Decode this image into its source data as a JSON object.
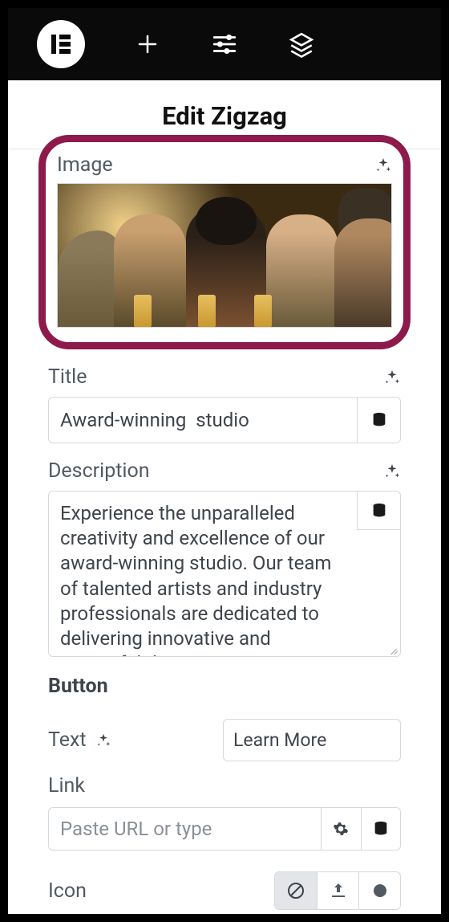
{
  "header": {
    "title": "Edit Zigzag"
  },
  "fields": {
    "image": {
      "label": "Image"
    },
    "title_field": {
      "label": "Title",
      "value": "Award-winning  studio"
    },
    "description": {
      "label": "Description",
      "value": "Experience the unparalleled creativity and excellence of our award-winning studio. Our team of talented artists and industry professionals are dedicated to delivering innovative and impactful designs."
    },
    "button": {
      "heading": "Button",
      "text_label": "Text",
      "text_value": "Learn More"
    },
    "link": {
      "label": "Link",
      "placeholder": "Paste URL or type"
    },
    "icon": {
      "label": "Icon"
    }
  }
}
